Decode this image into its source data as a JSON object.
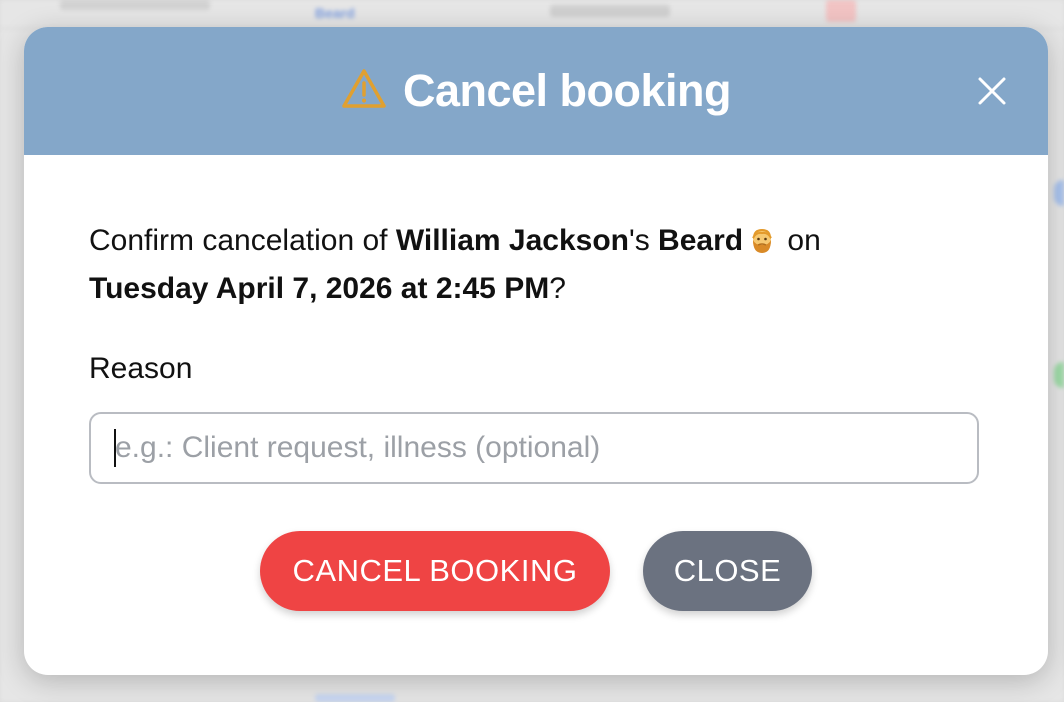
{
  "modal": {
    "title": "Cancel booking",
    "icons": {
      "warning": "warning-triangle-icon",
      "close": "close-icon",
      "emoji": "bearded-man-emoji"
    },
    "colors": {
      "header": "#84a7c9",
      "warning_icon": "#e0a030",
      "danger": "#ef4444",
      "neutral": "#6b7280"
    },
    "confirm": {
      "prefix": "Confirm cancelation of ",
      "client": "William Jackson",
      "possessive": "'s ",
      "service": "Beard",
      "on": " on",
      "datetime": "Tuesday April 7, 2026 at 2:45 PM",
      "suffix": "?"
    },
    "reason": {
      "label": "Reason",
      "placeholder": "e.g.: Client request, illness (optional)",
      "value": ""
    },
    "buttons": {
      "cancel_booking": "CANCEL BOOKING",
      "close": "CLOSE"
    }
  },
  "background": {
    "visible_service": "Beard"
  }
}
